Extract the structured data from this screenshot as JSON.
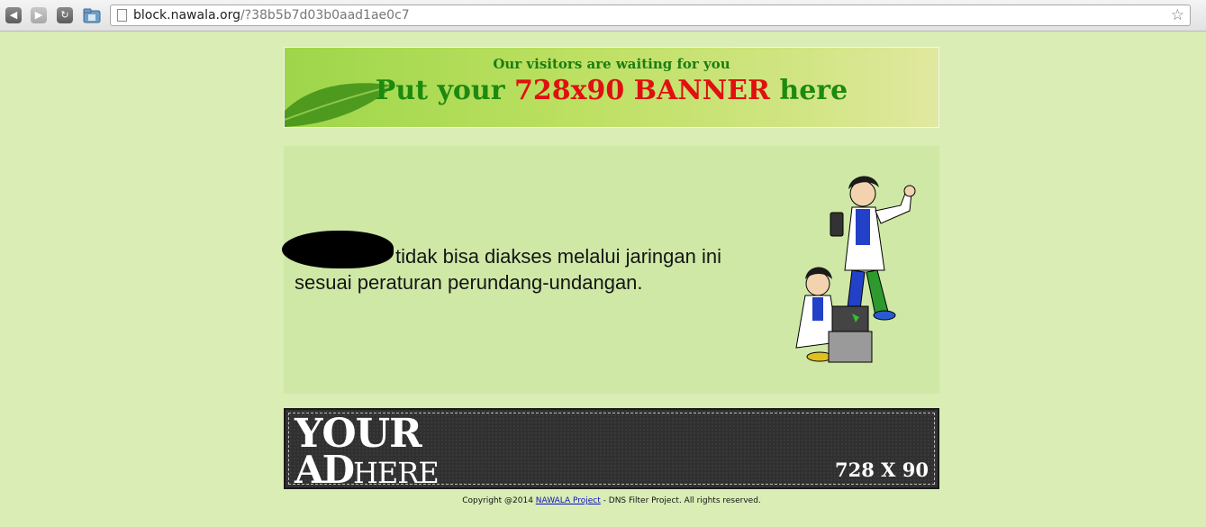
{
  "browser": {
    "url_domain": "block.nawala.org",
    "url_path": "/?38b5b7d03b0aad1ae0c7"
  },
  "top_banner": {
    "subtitle": "Our visitors are waiting for you",
    "headline_part1": "Put your ",
    "headline_part2": "728x90 BANNER",
    "headline_part3": " here"
  },
  "message": {
    "line1": "tidak bisa diakses melalui jaringan ini",
    "line2": "sesuai peraturan perundang-undangan."
  },
  "bottom_banner": {
    "your": "YOUR",
    "ad": "AD",
    "here": "HERE",
    "size": "728 X 90"
  },
  "footer": {
    "prefix": "Copyright @2014 ",
    "link": "NAWALA Project",
    "suffix": " - DNS Filter Project. All rights reserved."
  },
  "colors": {
    "page_bg": "#d9edb5",
    "content_bg": "#cfe8a6",
    "banner_green": "#1c8a0f",
    "banner_red": "#e01010",
    "ad_dark": "#303030"
  }
}
